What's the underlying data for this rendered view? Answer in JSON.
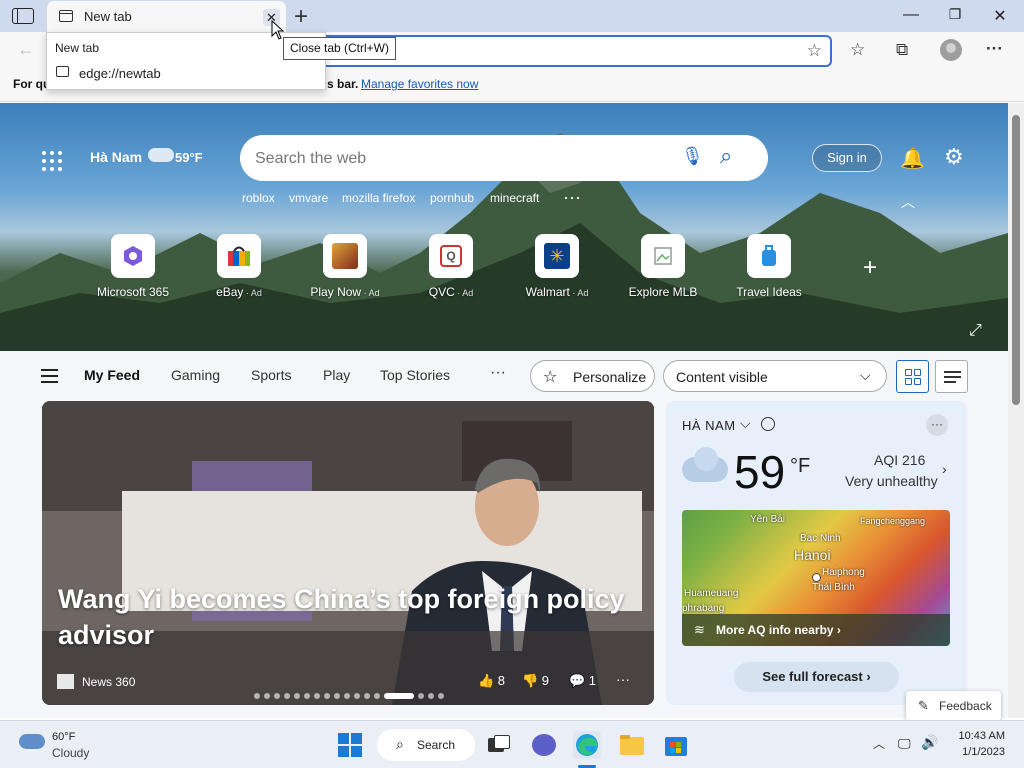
{
  "window": {
    "tab_title": "New tab",
    "tab_close_glyph": "✕",
    "new_tab_glyph": "+",
    "minimize_glyph": "—",
    "restore_glyph": "❐",
    "close_glyph": "✕"
  },
  "tab_dropdown": {
    "title": "New tab",
    "url": "edge://newtab"
  },
  "tooltip": "Close tab (Ctrl+W)",
  "toolbar": {
    "back_glyph": "←",
    "add_favorite_glyph": "☆",
    "favorites_glyph": "☆",
    "collections_glyph": "⧉",
    "more_glyph": "···"
  },
  "favorites_bar": {
    "text_start": "For qu",
    "text_end": "s bar.",
    "link": "Manage favorites now"
  },
  "hero": {
    "location": "Hà Nam",
    "temperature": "59°F",
    "search_placeholder": "Search the web",
    "mic_glyph": "🎙",
    "search_glyph": "⌕",
    "trending": [
      "roblox",
      "vmvare",
      "mozilla firefox",
      "pornhub",
      "minecraft"
    ],
    "trending_more": "···",
    "sign_in": "Sign in",
    "bell_glyph": "🔔",
    "gear_glyph": "⚙",
    "collapse_glyph": "︿",
    "add_glyph": "+",
    "expand_glyph": "⤢",
    "quick_links": [
      {
        "label": "Microsoft 365",
        "ad": ""
      },
      {
        "label": "eBay",
        "ad": " · Ad"
      },
      {
        "label": "Play Now",
        "ad": " · Ad"
      },
      {
        "label": "QVC",
        "ad": " · Ad"
      },
      {
        "label": "Walmart",
        "ad": " · Ad"
      },
      {
        "label": "Explore MLB",
        "ad": ""
      },
      {
        "label": "Travel Ideas",
        "ad": ""
      }
    ]
  },
  "feed_nav": {
    "tabs": [
      "My Feed",
      "Gaming",
      "Sports",
      "Play",
      "Top Stories"
    ],
    "more": "···",
    "personalize": "Personalize",
    "personalize_glyph": "☆",
    "visibility": "Content visible",
    "visibility_chevron": "⌵"
  },
  "hero_card": {
    "headline": "Wang Yi becomes China’s top foreign policy advisor",
    "source": "News 360",
    "likes": "👍 8",
    "dislikes": "👎 9",
    "comments": "💬 1",
    "more": "···"
  },
  "weather_card": {
    "location": "HÀ NAM",
    "location_chevron": "⌵",
    "more": "···",
    "temperature": "59",
    "unit": "°F",
    "aqi": "AQI 216",
    "aqi_status": "Very unhealthy",
    "aqi_chevron": "›",
    "map_labels": [
      "Yên Bái",
      "Bac Ninh",
      "Hanoi",
      "Haiphong",
      "Thái Bình",
      "Huameuang",
      "phrabang",
      "Fangchenggang"
    ],
    "map_link": "More AQ info nearby ›",
    "map_link_glyph": "≋",
    "forecast": "See full forecast ›"
  },
  "feedback": {
    "label": "Feedback",
    "glyph": "✎"
  },
  "taskbar": {
    "weather_temp": "60°F",
    "weather_condition": "Cloudy",
    "search_label": "Search",
    "search_glyph": "⌕",
    "tray_chevron": "︿",
    "network_glyph": "🖵",
    "volume_glyph": "🔊",
    "time": "10:43 AM",
    "date": "1/1/2023"
  },
  "colors": {
    "accent": "#1f63c5",
    "titlebar": "#cfdaee",
    "windows_blue": "#1c79d6"
  }
}
